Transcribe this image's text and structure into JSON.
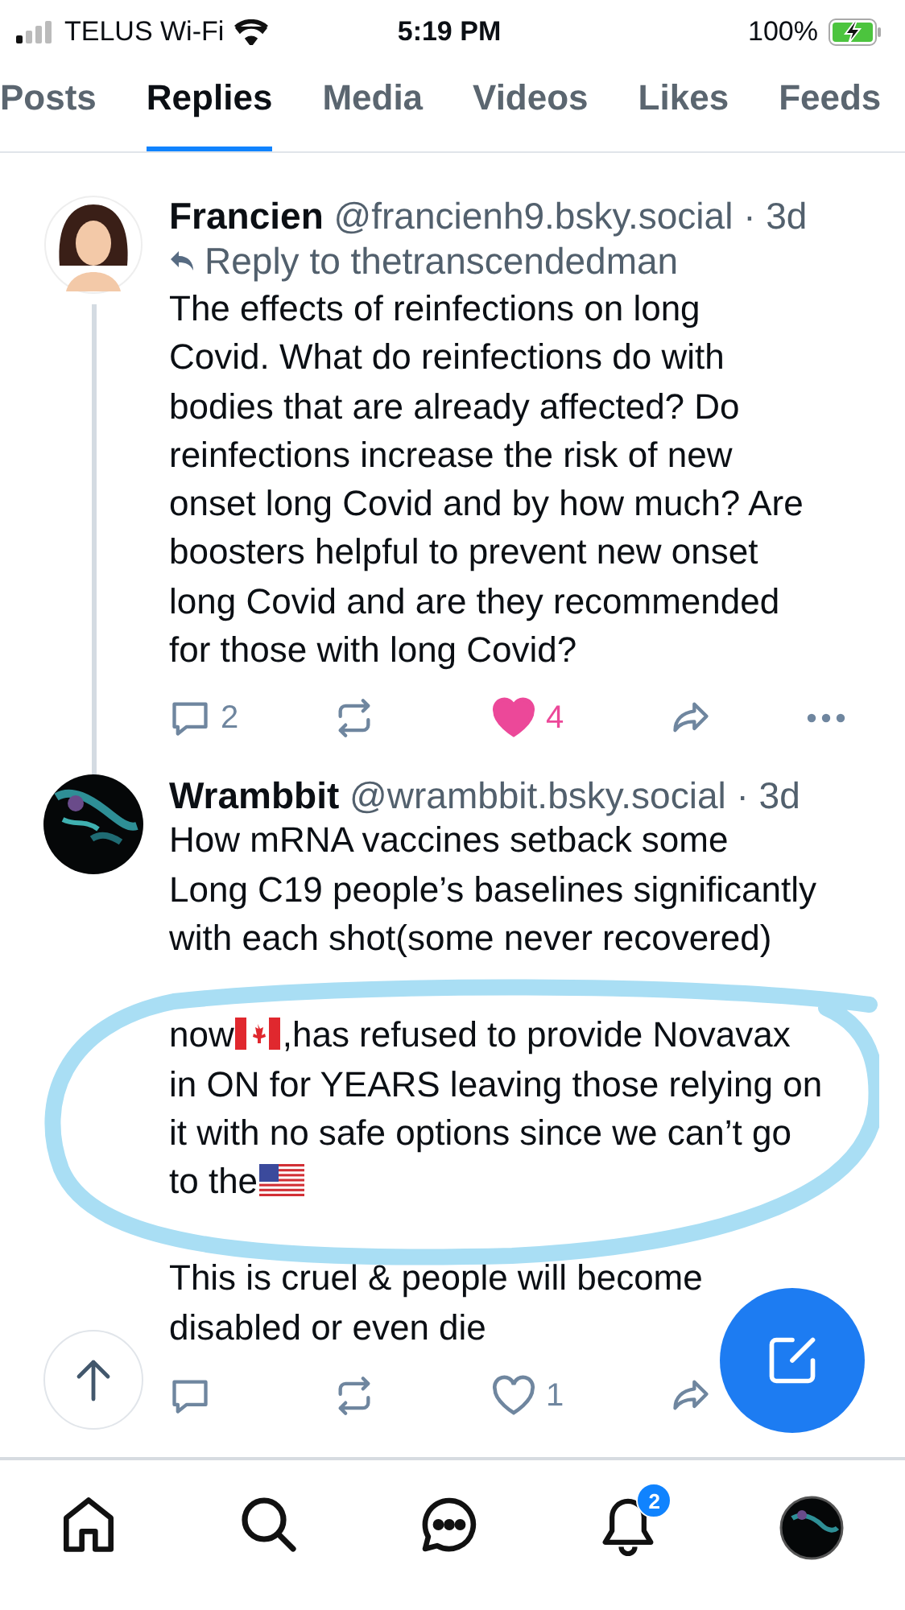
{
  "status_bar": {
    "carrier": "TELUS Wi-Fi",
    "time": "5:19 PM",
    "battery": "100%",
    "charging": true
  },
  "tabs": [
    {
      "label": "Posts",
      "selected": false
    },
    {
      "label": "Replies",
      "selected": true
    },
    {
      "label": "Media",
      "selected": false
    },
    {
      "label": "Videos",
      "selected": false
    },
    {
      "label": "Likes",
      "selected": false
    },
    {
      "label": "Feeds",
      "selected": false
    }
  ],
  "posts": [
    {
      "author": "Francien",
      "meta": "@francienh9.bsky.social · 3d",
      "avatar": {
        "kind": "figure"
      },
      "reply_to": "Reply to thetranscendedman",
      "thread_line": true,
      "paragraphs": [
        [
          {
            "kind": "text",
            "text": "The effects of reinfections on long\nCovid. What do reinfections do with\nbodies that are already affected? Do\nreinfections increase the risk of new\nonset long Covid and by how much? Are\nboosters helpful to prevent new onset\nlong Covid and are they recommended\nfor those with long Covid?"
          }
        ]
      ],
      "replies": "2",
      "likes": "4",
      "liked": true,
      "more_menu": true
    },
    {
      "author": "Wrambbit",
      "meta": "@wrambbit.bsky.social · 3d",
      "avatar": {
        "kind": "picture"
      },
      "paragraphs": [
        [
          {
            "kind": "text",
            "text": "How mRNA vaccines setback some\nLong C19 people’s baselines significantly\nwith each shot(some never recovered)"
          }
        ],
        [
          {
            "kind": "text",
            "text": "now"
          },
          {
            "kind": "canada_flag"
          },
          {
            "kind": "text",
            "text": ",has refused to provide Novavax\nin ON for YEARS leaving those relying on\nit with no safe options since we can’t go\nto the"
          },
          {
            "kind": "us_flag"
          }
        ],
        [
          {
            "kind": "text",
            "text": "This is cruel & people will become\ndisabled or even die"
          }
        ]
      ],
      "likes": "1",
      "liked": false
    }
  ],
  "nav": {
    "notifications_badge": "2"
  }
}
